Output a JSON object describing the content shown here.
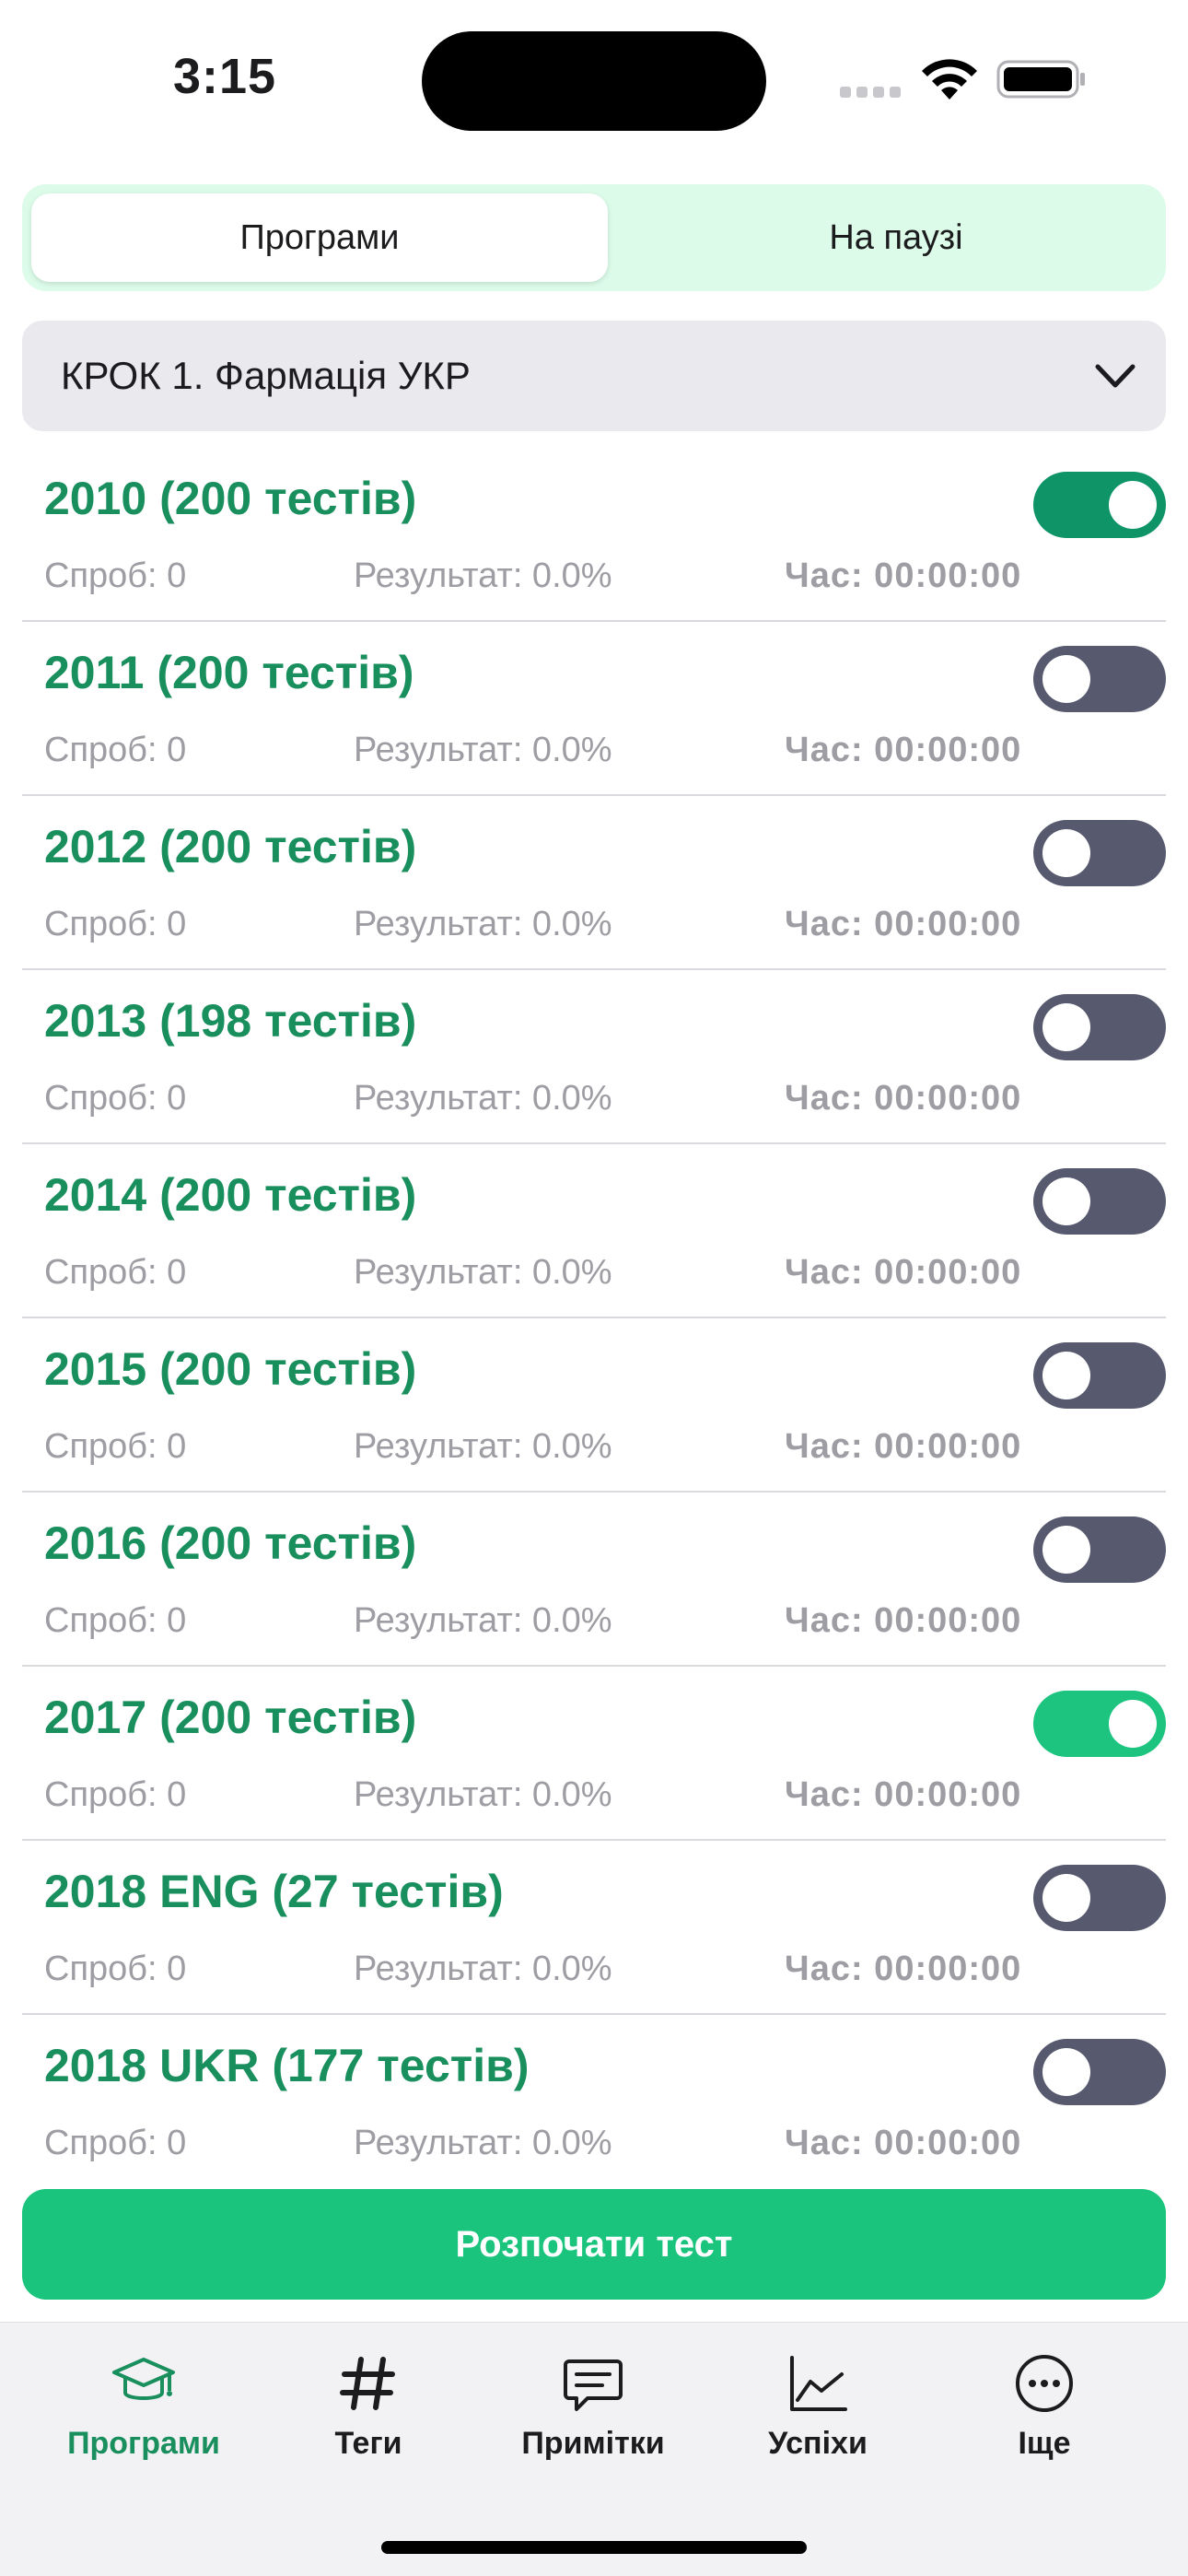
{
  "status_bar": {
    "time": "3:15"
  },
  "segmented": {
    "tab_programs": "Програми",
    "tab_paused": "На паузі"
  },
  "dropdown": {
    "selected": "КРОК 1. Фармація УКР"
  },
  "programs": [
    {
      "title": "2010 (200 тестів)",
      "attempts": "Спроб: 0",
      "result": "Результат: 0.0%",
      "time": "Час: 00:00:00",
      "enabled": true
    },
    {
      "title": "2011 (200 тестів)",
      "attempts": "Спроб: 0",
      "result": "Результат: 0.0%",
      "time": "Час: 00:00:00",
      "enabled": false
    },
    {
      "title": "2012 (200 тестів)",
      "attempts": "Спроб: 0",
      "result": "Результат: 0.0%",
      "time": "Час: 00:00:00",
      "enabled": false
    },
    {
      "title": "2013 (198 тестів)",
      "attempts": "Спроб: 0",
      "result": "Результат: 0.0%",
      "time": "Час: 00:00:00",
      "enabled": false
    },
    {
      "title": "2014 (200 тестів)",
      "attempts": "Спроб: 0",
      "result": "Результат: 0.0%",
      "time": "Час: 00:00:00",
      "enabled": false
    },
    {
      "title": "2015 (200 тестів)",
      "attempts": "Спроб: 0",
      "result": "Результат: 0.0%",
      "time": "Час: 00:00:00",
      "enabled": false
    },
    {
      "title": "2016 (200 тестів)",
      "attempts": "Спроб: 0",
      "result": "Результат: 0.0%",
      "time": "Час: 00:00:00",
      "enabled": false
    },
    {
      "title": "2017 (200 тестів)",
      "attempts": "Спроб: 0",
      "result": "Результат: 0.0%",
      "time": "Час: 00:00:00",
      "enabled": true
    },
    {
      "title": "2018 ENG (27 тестів)",
      "attempts": "Спроб: 0",
      "result": "Результат: 0.0%",
      "time": "Час: 00:00:00",
      "enabled": false
    },
    {
      "title": "2018 UKR (177 тестів)",
      "attempts": "Спроб: 0",
      "result": "Результат: 0.0%",
      "time": "Час: 00:00:00",
      "enabled": false
    }
  ],
  "start_button": {
    "label": "Розпочати тест"
  },
  "tab_bar": {
    "items": [
      {
        "label": "Програми",
        "icon": "graduation-cap-icon",
        "active": true
      },
      {
        "label": "Теги",
        "icon": "hashtag-icon",
        "active": false
      },
      {
        "label": "Примітки",
        "icon": "chat-bubble-icon",
        "active": false
      },
      {
        "label": "Успіхи",
        "icon": "line-chart-icon",
        "active": false
      },
      {
        "label": "Іще",
        "icon": "more-icon",
        "active": false
      }
    ]
  },
  "colors": {
    "accent": "#1a8f5e",
    "button": "#1ac47d",
    "toggle_on": "#0e9466",
    "toggle_off": "#575a6e",
    "segment_bg": "#dcfbe9"
  }
}
